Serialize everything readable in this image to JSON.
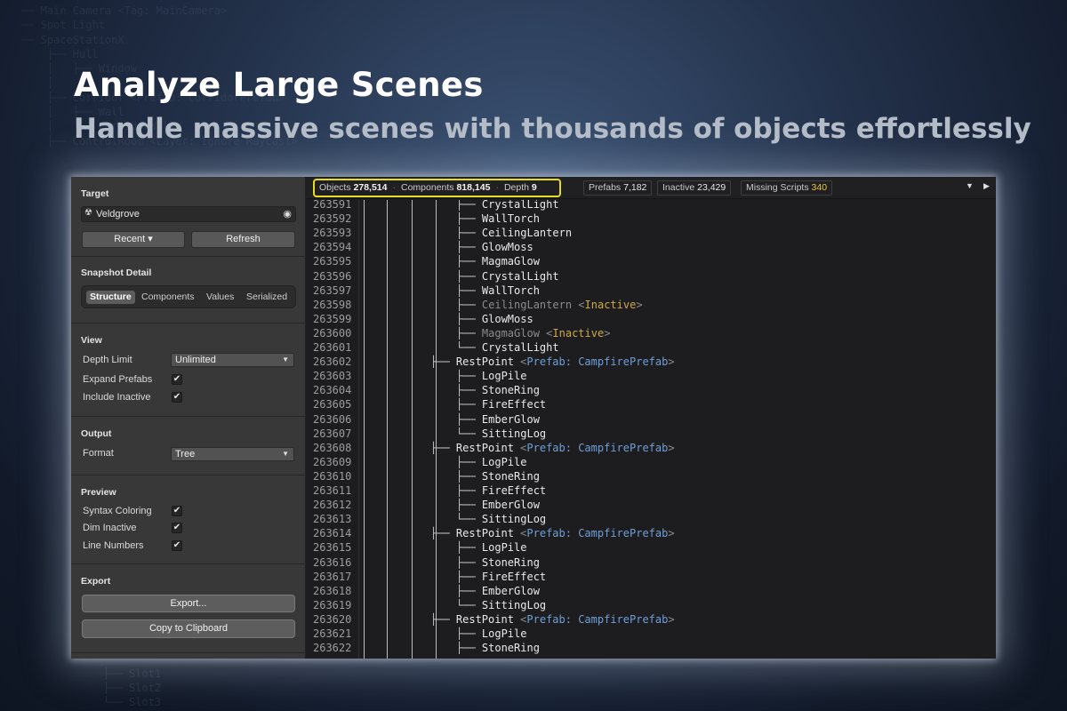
{
  "background_tree": {
    "top_lines": [
      "── Main Camera <Tag: MainCamera>",
      "── Spot Light",
      "── SpaceStationX",
      "    ├── Hull",
      "    │   ├── Window",
      "    │",
      "    ├── Corridor <Prefab: CorridorPrefab>",
      "    │   ├── Wall",
      "    │   └── CorridorWalls",
      "    ├── ControlRoom <Layer: Ignore Raycast>"
    ],
    "bottom_lines": [
      "├── Slot1",
      "├── Slot2",
      "└── Slot3"
    ]
  },
  "headline": "Analyze Large Scenes",
  "subheadline": "Handle massive scenes with thousands of objects effortlessly",
  "panel": {
    "target": {
      "title": "Target",
      "field_value": "Veldgrove",
      "recent_label": "Recent ▾",
      "refresh_label": "Refresh"
    },
    "snapshot": {
      "title": "Snapshot Detail",
      "tabs": [
        "Structure",
        "Components",
        "Values",
        "Serialized"
      ],
      "active_tab": "Structure"
    },
    "view": {
      "title": "View",
      "depth_limit_label": "Depth Limit",
      "depth_limit_value": "Unlimited",
      "expand_prefabs_label": "Expand Prefabs",
      "expand_prefabs_checked": true,
      "include_inactive_label": "Include Inactive",
      "include_inactive_checked": true
    },
    "output": {
      "title": "Output",
      "format_label": "Format",
      "format_value": "Tree"
    },
    "preview": {
      "title": "Preview",
      "syntax_label": "Syntax Coloring",
      "dim_label": "Dim Inactive",
      "line_numbers_label": "Line Numbers",
      "all_checked": true
    },
    "export": {
      "title": "Export",
      "export_label": "Export...",
      "copy_label": "Copy to Clipboard"
    },
    "check_glyph": "✔"
  },
  "toolbar": {
    "objects_label": "Objects",
    "objects_value": "278,514",
    "components_label": "Components",
    "components_value": "818,145",
    "depth_label": "Depth",
    "depth_value": "9",
    "prefabs_label": "Prefabs",
    "prefabs_value": "7,182",
    "inactive_label": "Inactive",
    "inactive_value": "23,429",
    "missing_label": "Missing Scripts",
    "missing_value": "340",
    "separator": "·",
    "collapse_icon": "▼",
    "expand_icon": "▶"
  },
  "colors": {
    "highlight": "#e6dc25",
    "prefab_tag": "#6f9fd9",
    "inactive_tag": "#cfa94a"
  },
  "code_lines": [
    {
      "n": "263591",
      "prefix": "├── ",
      "name": "CrystalLight",
      "depth": 2
    },
    {
      "n": "263592",
      "prefix": "├── ",
      "name": "WallTorch",
      "depth": 2
    },
    {
      "n": "263593",
      "prefix": "├── ",
      "name": "CeilingLantern",
      "depth": 2
    },
    {
      "n": "263594",
      "prefix": "├── ",
      "name": "GlowMoss",
      "depth": 2
    },
    {
      "n": "263595",
      "prefix": "├── ",
      "name": "MagmaGlow",
      "depth": 2
    },
    {
      "n": "263596",
      "prefix": "├── ",
      "name": "CrystalLight",
      "depth": 2
    },
    {
      "n": "263597",
      "prefix": "├── ",
      "name": "WallTorch",
      "depth": 2
    },
    {
      "n": "263598",
      "prefix": "├── ",
      "name": "CeilingLantern",
      "depth": 2,
      "inactive": true,
      "tag": "Inactive"
    },
    {
      "n": "263599",
      "prefix": "├── ",
      "name": "GlowMoss",
      "depth": 2
    },
    {
      "n": "263600",
      "prefix": "├── ",
      "name": "MagmaGlow",
      "depth": 2,
      "inactive": true,
      "tag": "Inactive"
    },
    {
      "n": "263601",
      "prefix": "└── ",
      "name": "CrystalLight",
      "depth": 2
    },
    {
      "n": "263602",
      "prefix": "├── ",
      "name": "RestPoint",
      "depth": 1,
      "prefab": "Prefab: CampfirePrefab"
    },
    {
      "n": "263603",
      "prefix": "├── ",
      "name": "LogPile",
      "depth": 2
    },
    {
      "n": "263604",
      "prefix": "├── ",
      "name": "StoneRing",
      "depth": 2
    },
    {
      "n": "263605",
      "prefix": "├── ",
      "name": "FireEffect",
      "depth": 2
    },
    {
      "n": "263606",
      "prefix": "├── ",
      "name": "EmberGlow",
      "depth": 2
    },
    {
      "n": "263607",
      "prefix": "└── ",
      "name": "SittingLog",
      "depth": 2
    },
    {
      "n": "263608",
      "prefix": "├── ",
      "name": "RestPoint",
      "depth": 1,
      "prefab": "Prefab: CampfirePrefab"
    },
    {
      "n": "263609",
      "prefix": "├── ",
      "name": "LogPile",
      "depth": 2
    },
    {
      "n": "263610",
      "prefix": "├── ",
      "name": "StoneRing",
      "depth": 2
    },
    {
      "n": "263611",
      "prefix": "├── ",
      "name": "FireEffect",
      "depth": 2
    },
    {
      "n": "263612",
      "prefix": "├── ",
      "name": "EmberGlow",
      "depth": 2
    },
    {
      "n": "263613",
      "prefix": "└── ",
      "name": "SittingLog",
      "depth": 2
    },
    {
      "n": "263614",
      "prefix": "├── ",
      "name": "RestPoint",
      "depth": 1,
      "prefab": "Prefab: CampfirePrefab"
    },
    {
      "n": "263615",
      "prefix": "├── ",
      "name": "LogPile",
      "depth": 2
    },
    {
      "n": "263616",
      "prefix": "├── ",
      "name": "StoneRing",
      "depth": 2
    },
    {
      "n": "263617",
      "prefix": "├── ",
      "name": "FireEffect",
      "depth": 2
    },
    {
      "n": "263618",
      "prefix": "├── ",
      "name": "EmberGlow",
      "depth": 2
    },
    {
      "n": "263619",
      "prefix": "└── ",
      "name": "SittingLog",
      "depth": 2
    },
    {
      "n": "263620",
      "prefix": "├── ",
      "name": "RestPoint",
      "depth": 1,
      "prefab": "Prefab: CampfirePrefab"
    },
    {
      "n": "263621",
      "prefix": "├── ",
      "name": "LogPile",
      "depth": 2
    },
    {
      "n": "263622",
      "prefix": "├── ",
      "name": "StoneRing",
      "depth": 2
    }
  ]
}
